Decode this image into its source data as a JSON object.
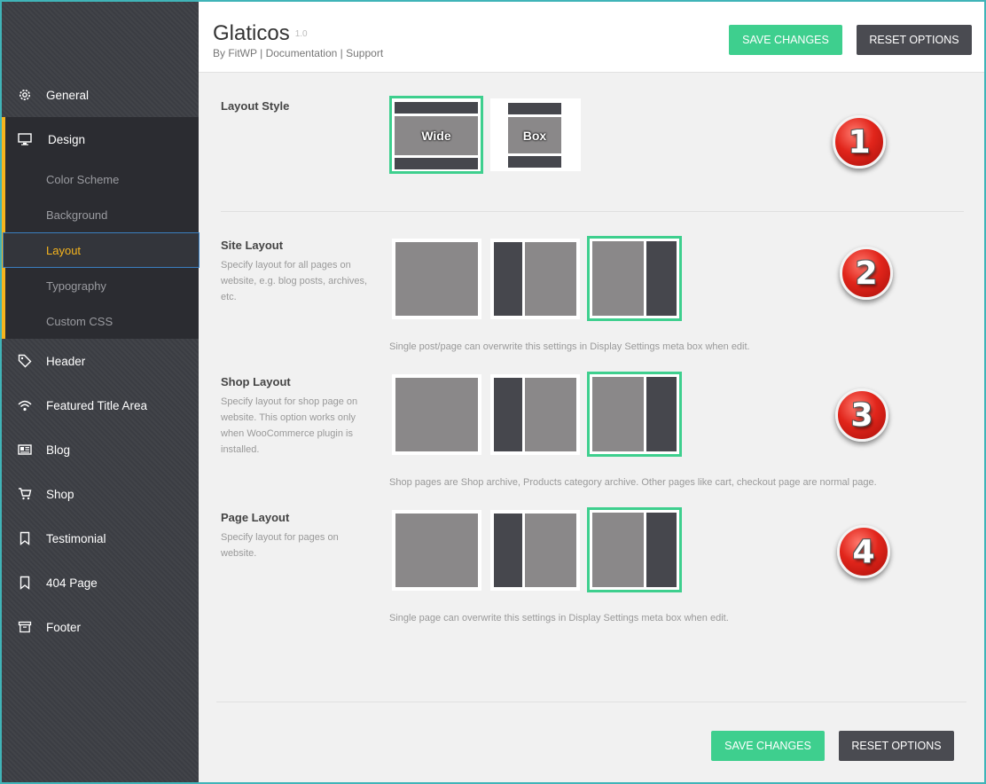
{
  "app": {
    "title": "Glaticos",
    "version": "1.0"
  },
  "byline": {
    "by": "By FitWP",
    "sep1": "|",
    "documentation": "Documentation",
    "sep2": "|",
    "support": "Support"
  },
  "header_buttons": {
    "save": "SAVE CHANGES",
    "reset": "RESET OPTIONS"
  },
  "footer_buttons": {
    "save": "SAVE CHANGES",
    "reset": "RESET OPTIONS"
  },
  "sidebar": {
    "general": "General",
    "design": "Design",
    "design_sub": [
      "Color Scheme",
      "Background",
      "Layout",
      "Typography",
      "Custom CSS"
    ],
    "active_sub": "Layout",
    "items": [
      "Header",
      "Featured Title Area",
      "Blog",
      "Shop",
      "Testimonial",
      "404 Page",
      "Footer"
    ]
  },
  "sections": {
    "layout_style": {
      "title": "Layout Style",
      "options": [
        "Wide",
        "Box"
      ],
      "selected": "Wide",
      "badge": "1"
    },
    "site_layout": {
      "title": "Site Layout",
      "desc": "Specify layout for all pages on website, e.g. blog posts, archives, etc.",
      "note": "Single post/page can overwrite this settings in Display Settings meta box when edit.",
      "options": [
        "no-sidebar",
        "sidebar-left",
        "sidebar-right"
      ],
      "selected": "sidebar-right",
      "badge": "2"
    },
    "shop_layout": {
      "title": "Shop Layout",
      "desc": "Specify layout for shop page on website. This option works only when WooCommerce plugin is installed.",
      "note": "Shop pages are Shop archive, Products category archive. Other pages like cart, checkout page are normal page.",
      "options": [
        "no-sidebar",
        "sidebar-left",
        "sidebar-right"
      ],
      "selected": "sidebar-right",
      "badge": "3"
    },
    "page_layout": {
      "title": "Page Layout",
      "desc": "Specify layout for pages on website.",
      "note": "Single page can overwrite this settings in Display Settings meta box when edit.",
      "options": [
        "no-sidebar",
        "sidebar-left",
        "sidebar-right"
      ],
      "selected": "sidebar-right",
      "badge": "4"
    }
  },
  "colors": {
    "accent_green": "#3ecf8e",
    "accent_yellow": "#f5b41e",
    "sidebar_bg": "#3d3f45",
    "badge_red": "#e1251b"
  },
  "icons": [
    "gear-icon",
    "monitor-icon",
    "tag-icon",
    "wifi-icon",
    "newspaper-icon",
    "cart-icon",
    "bookmark-icon",
    "bookmark-icon",
    "archive-icon"
  ]
}
